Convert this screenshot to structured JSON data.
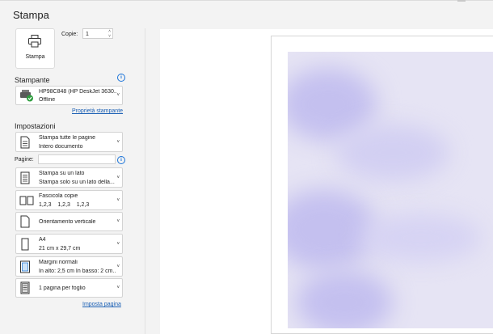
{
  "header": {
    "title": "Stampa"
  },
  "print_button": {
    "label": "Stampa",
    "icon": "printer-icon"
  },
  "copies": {
    "label": "Copie:",
    "value": "1"
  },
  "printer_section": {
    "title": "Stampante",
    "name": "HP98C848 (HP DeskJet 3630...",
    "status": "Offline",
    "properties_link": "Proprietà stampante"
  },
  "settings_section": {
    "title": "Impostazioni",
    "pages_label": "Pagine:",
    "pages_value": "",
    "options": [
      {
        "line1": "Stampa tutte le pagine",
        "line2": "Intero documento",
        "icon": "document-pages-icon"
      },
      {
        "line1": "Stampa su un lato",
        "line2": "Stampa solo su un lato della...",
        "icon": "single-side-icon"
      },
      {
        "line1": "Fascicola copie",
        "line2": "1,2,3    1,2,3    1,2,3",
        "icon": "collate-icon"
      },
      {
        "line1": "Orientamento verticale",
        "line2": "",
        "icon": "portrait-icon"
      },
      {
        "line1": "A4",
        "line2": "21 cm x 29,7 cm",
        "icon": "paper-size-icon"
      },
      {
        "line1": "Margini normali",
        "line2": "In alto: 2,5 cm In basso: 2 cm...",
        "icon": "margins-icon"
      },
      {
        "line1": "1 pagina per foglio",
        "line2": "",
        "icon": "pages-per-sheet-icon"
      }
    ],
    "page_setup_link": "Imposta pagina"
  },
  "colors": {
    "accent": "#1a73d8",
    "link": "#1a5fb4",
    "status_ok": "#2e9e3e"
  }
}
